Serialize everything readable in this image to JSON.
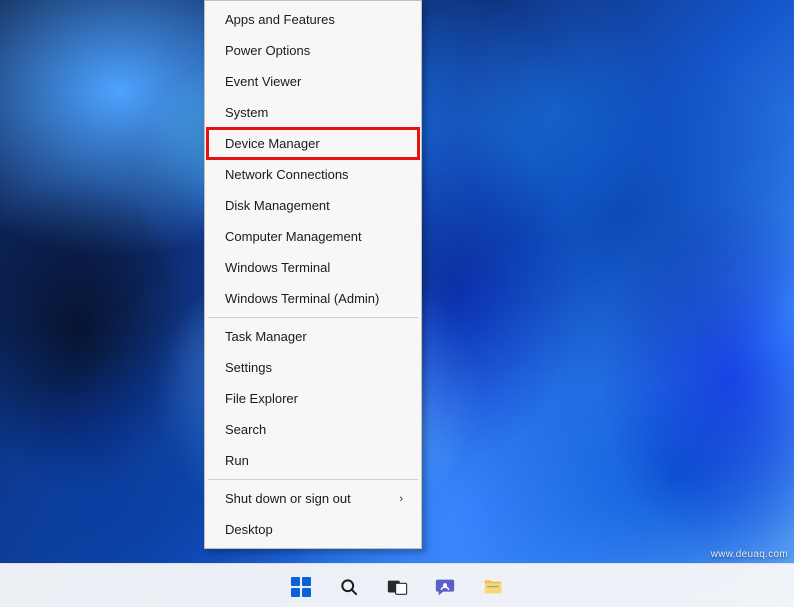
{
  "watermark": "www.deuaq.com",
  "menu": {
    "groups": [
      [
        {
          "id": "apps-features",
          "label": "Apps and Features",
          "highlight": false,
          "submenu": false
        },
        {
          "id": "power-options",
          "label": "Power Options",
          "highlight": false,
          "submenu": false
        },
        {
          "id": "event-viewer",
          "label": "Event Viewer",
          "highlight": false,
          "submenu": false
        },
        {
          "id": "system",
          "label": "System",
          "highlight": false,
          "submenu": false
        },
        {
          "id": "device-manager",
          "label": "Device Manager",
          "highlight": true,
          "submenu": false
        },
        {
          "id": "network-conn",
          "label": "Network Connections",
          "highlight": false,
          "submenu": false
        },
        {
          "id": "disk-management",
          "label": "Disk Management",
          "highlight": false,
          "submenu": false
        },
        {
          "id": "computer-mgmt",
          "label": "Computer Management",
          "highlight": false,
          "submenu": false
        },
        {
          "id": "win-terminal",
          "label": "Windows Terminal",
          "highlight": false,
          "submenu": false
        },
        {
          "id": "win-terminal-adm",
          "label": "Windows Terminal (Admin)",
          "highlight": false,
          "submenu": false
        }
      ],
      [
        {
          "id": "task-manager",
          "label": "Task Manager",
          "highlight": false,
          "submenu": false
        },
        {
          "id": "settings",
          "label": "Settings",
          "highlight": false,
          "submenu": false
        },
        {
          "id": "file-explorer",
          "label": "File Explorer",
          "highlight": false,
          "submenu": false
        },
        {
          "id": "search",
          "label": "Search",
          "highlight": false,
          "submenu": false
        },
        {
          "id": "run",
          "label": "Run",
          "highlight": false,
          "submenu": false
        }
      ],
      [
        {
          "id": "shutdown-signout",
          "label": "Shut down or sign out",
          "highlight": false,
          "submenu": true
        },
        {
          "id": "desktop",
          "label": "Desktop",
          "highlight": false,
          "submenu": false
        }
      ]
    ]
  },
  "taskbar": {
    "items": [
      {
        "id": "start",
        "icon": "windows-logo-icon"
      },
      {
        "id": "search",
        "icon": "search-icon"
      },
      {
        "id": "taskview",
        "icon": "task-view-icon"
      },
      {
        "id": "chat",
        "icon": "chat-icon"
      },
      {
        "id": "file-explorer",
        "icon": "file-explorer-icon"
      }
    ]
  }
}
